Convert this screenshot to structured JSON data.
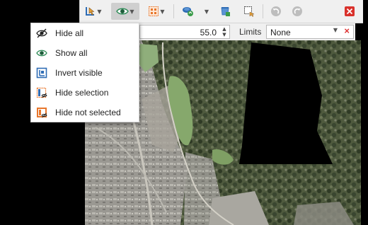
{
  "toolbar": {
    "buttons": [
      {
        "name": "select-tool",
        "icon": "select-cursor-icon",
        "has_dropdown": true
      },
      {
        "name": "visibility",
        "icon": "eye-icon",
        "has_dropdown": true,
        "pressed": true
      },
      {
        "name": "grid-select",
        "icon": "grid-select-icon",
        "has_dropdown": true
      },
      {
        "name": "layers-refresh",
        "icon": "layers-refresh-icon",
        "has_dropdown": true
      },
      {
        "name": "bucket",
        "icon": "bucket-icon",
        "has_dropdown": false
      },
      {
        "name": "magic-select",
        "icon": "magic-select-icon",
        "has_dropdown": false
      },
      {
        "name": "undo",
        "icon": "undo-icon",
        "enabled": false
      },
      {
        "name": "redo",
        "icon": "redo-icon",
        "enabled": false
      },
      {
        "name": "close",
        "icon": "close-icon",
        "color": "#d9312b"
      }
    ]
  },
  "parameters": {
    "numeric_value": "55.0",
    "limits_label": "Limits",
    "limits_value": "None"
  },
  "menu": {
    "items": [
      {
        "label": "Hide all",
        "icon": "eye-closed-icon"
      },
      {
        "label": "Show all",
        "icon": "eye-open-icon"
      },
      {
        "label": "Invert visible",
        "icon": "invert-visible-icon"
      },
      {
        "label": "Hide selection",
        "icon": "hide-selection-icon"
      },
      {
        "label": "Hide not selected",
        "icon": "hide-not-selected-icon"
      }
    ]
  },
  "colors": {
    "accent_blue": "#2f6db5",
    "eye_green": "#2e8b57",
    "selection_orange": "#e8762b",
    "close_red": "#d9312b"
  }
}
